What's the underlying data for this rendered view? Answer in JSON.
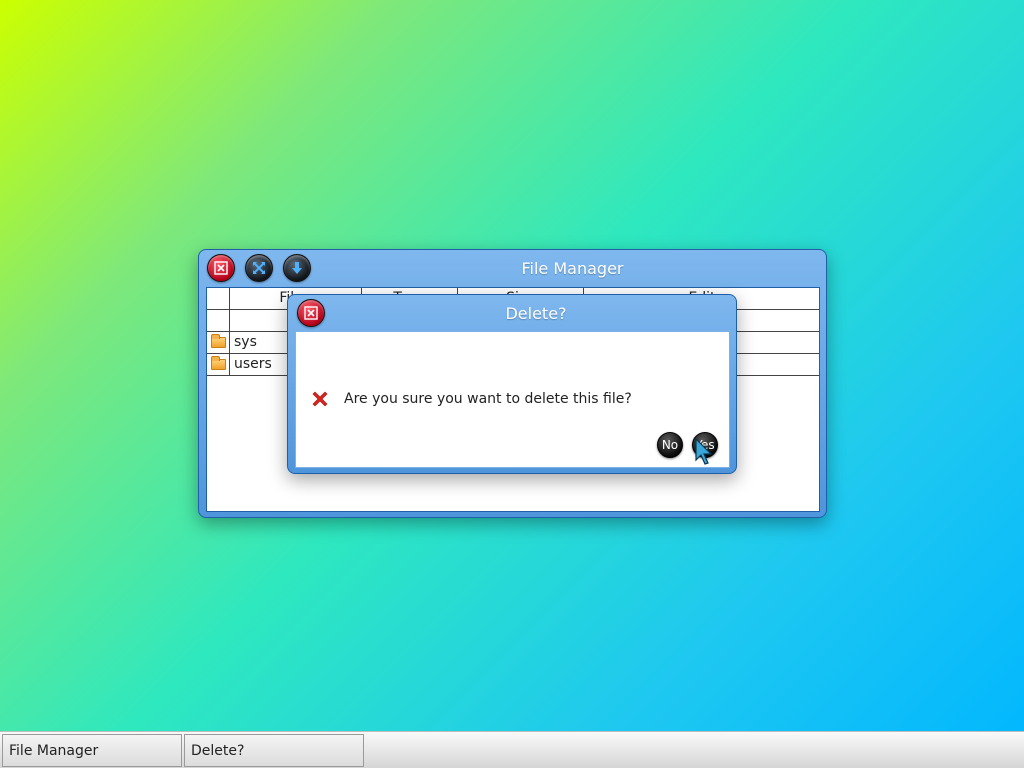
{
  "file_manager": {
    "title": "File Manager",
    "columns": [
      "",
      "Filen",
      "Type",
      "Size",
      "Edit"
    ],
    "rows": [
      {
        "name": ""
      },
      {
        "name": "sys"
      },
      {
        "name": "users"
      }
    ]
  },
  "dialog": {
    "title": "Delete?",
    "message": "Are you sure you want to delete this file?",
    "no_label": "No",
    "yes_label": "Yes"
  },
  "taskbar": {
    "items": [
      {
        "label": "File Manager"
      },
      {
        "label": "Delete?"
      }
    ]
  },
  "colors": {
    "window_title": "#5b9ee3",
    "close_button": "#c0122a",
    "error_icon": "#d9251f"
  }
}
